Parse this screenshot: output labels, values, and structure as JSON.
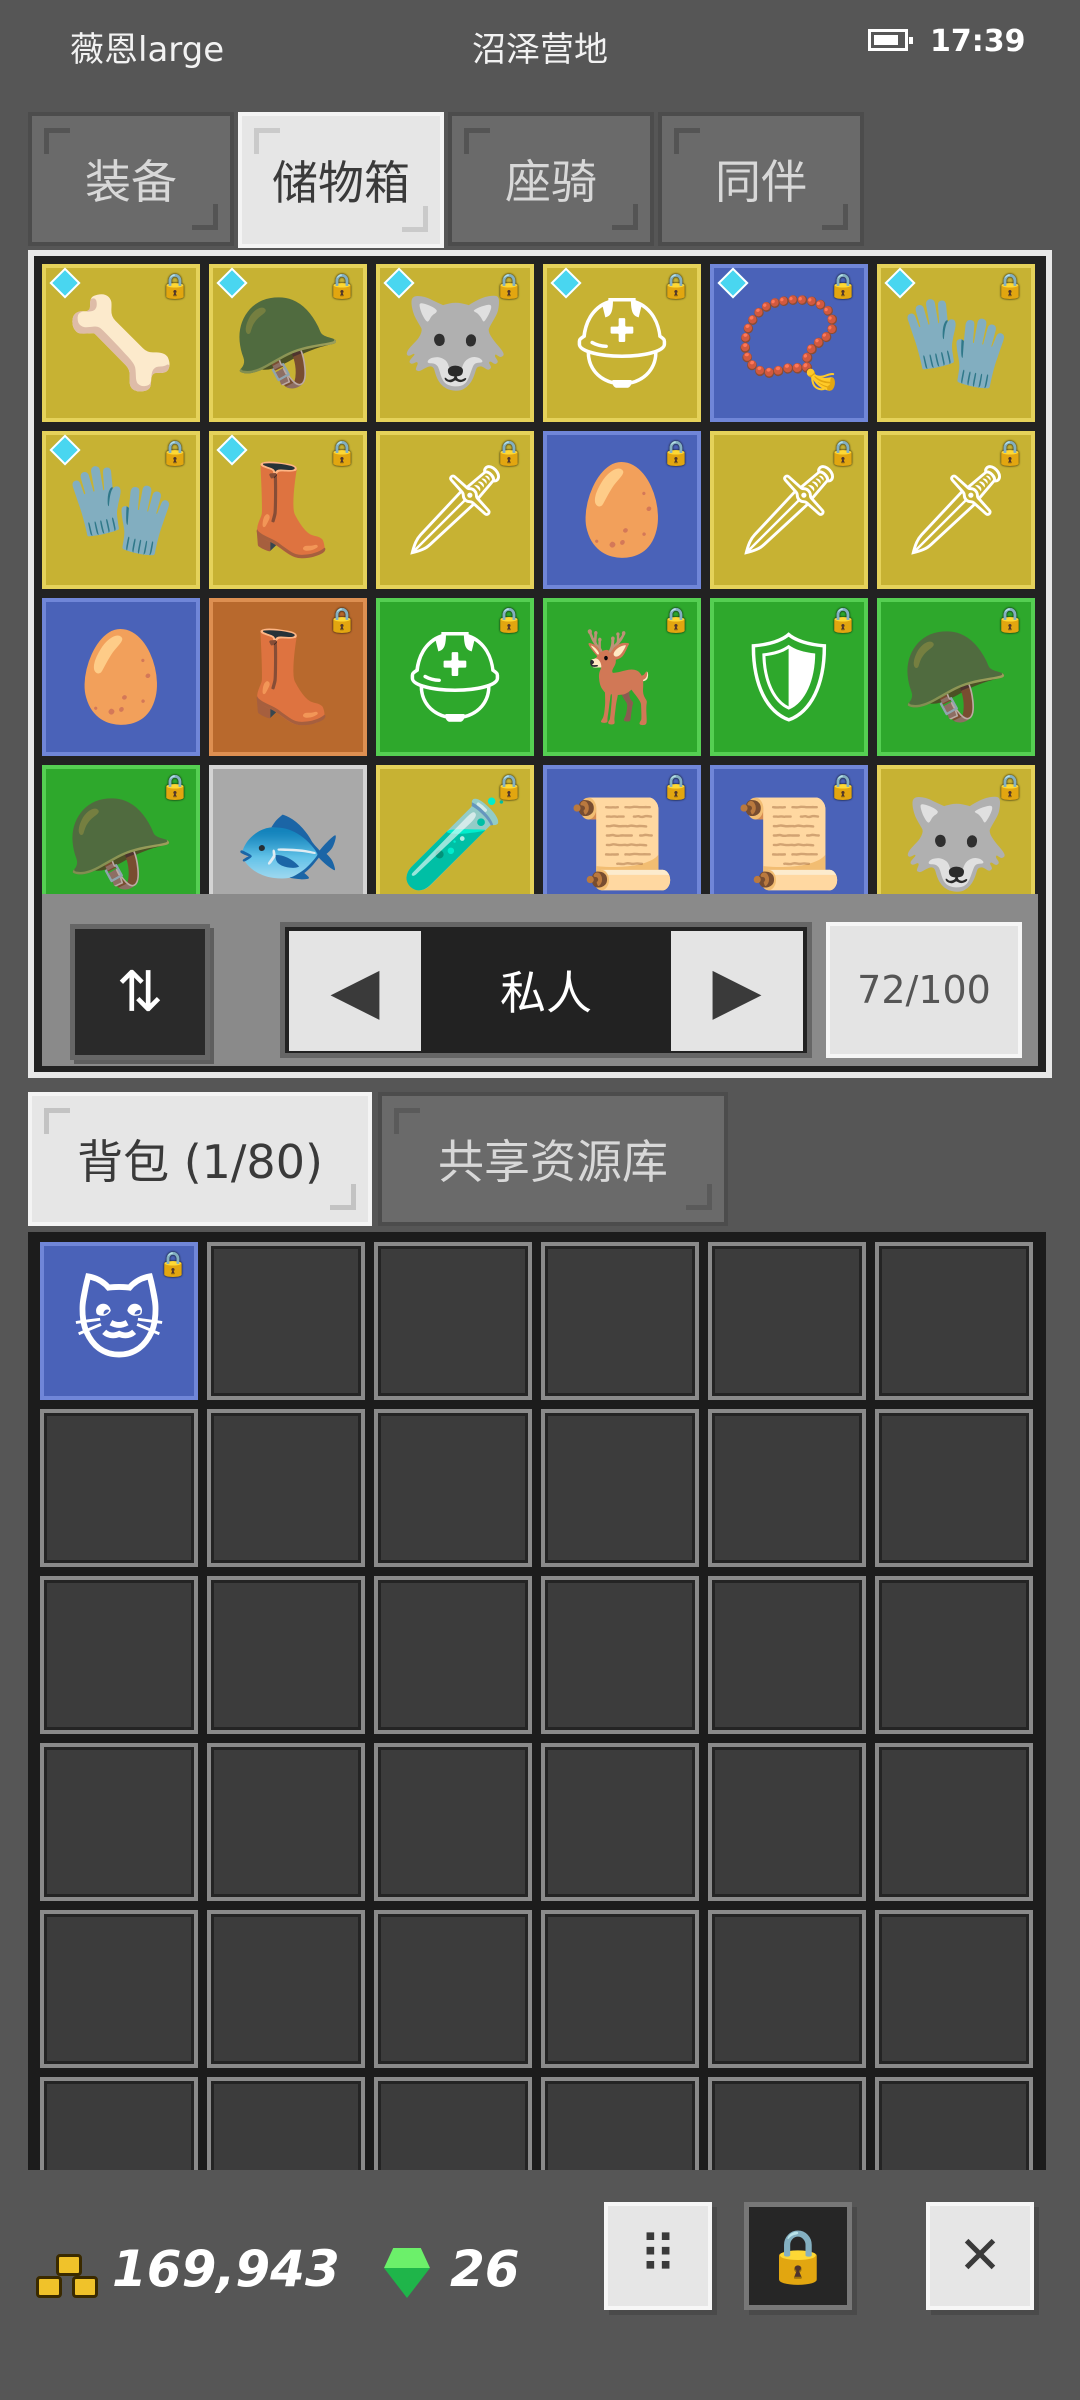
{
  "status_bar": {
    "player_name": "薇恩large",
    "location": "沼泽营地",
    "time": "17:39"
  },
  "top_tabs": [
    {
      "label": "装备",
      "active": false
    },
    {
      "label": "储物箱",
      "active": true
    },
    {
      "label": "座骑",
      "active": false
    },
    {
      "label": "同伴",
      "active": false
    }
  ],
  "storage": {
    "rows": [
      [
        {
          "color": "yellow",
          "icon": "rib-armor-icon",
          "glyph": "🦴",
          "gem": true,
          "locked": true
        },
        {
          "color": "yellow",
          "icon": "dark-helm-icon",
          "glyph": "🪖",
          "gem": true,
          "locked": true
        },
        {
          "color": "yellow",
          "icon": "fur-hood-icon",
          "glyph": "🐺",
          "gem": true,
          "locked": true
        },
        {
          "color": "yellow",
          "icon": "helmet-icon",
          "glyph": "⛑",
          "gem": true,
          "locked": true
        },
        {
          "color": "blue",
          "icon": "ruby-amulet-icon",
          "glyph": "📿",
          "gem": true,
          "locked": true
        },
        {
          "color": "yellow",
          "icon": "gauntlet-icon",
          "glyph": "🧤",
          "gem": true,
          "locked": true
        }
      ],
      [
        {
          "color": "yellow",
          "icon": "gauntlet-icon",
          "glyph": "🧤",
          "gem": true,
          "locked": true
        },
        {
          "color": "yellow",
          "icon": "boots-icon",
          "glyph": "👢",
          "gem": true,
          "locked": true
        },
        {
          "color": "yellow",
          "icon": "spear-icon",
          "glyph": "🗡",
          "gem": false,
          "locked": true
        },
        {
          "color": "blue",
          "icon": "white-egg-icon",
          "glyph": "🥚",
          "gem": false,
          "locked": true
        },
        {
          "color": "yellow",
          "icon": "spear-icon",
          "glyph": "🗡",
          "gem": false,
          "locked": true
        },
        {
          "color": "yellow",
          "icon": "spear-icon",
          "glyph": "🗡",
          "gem": false,
          "locked": true
        }
      ],
      [
        {
          "color": "blue",
          "icon": "egg-icon",
          "glyph": "🥚",
          "gem": false,
          "locked": false
        },
        {
          "color": "orange",
          "icon": "red-boots-icon",
          "glyph": "👢",
          "gem": false,
          "locked": true
        },
        {
          "color": "green",
          "icon": "helmet-icon",
          "glyph": "⛑",
          "gem": false,
          "locked": true
        },
        {
          "color": "green",
          "icon": "antler-helm-icon",
          "glyph": "🦌",
          "gem": false,
          "locked": true
        },
        {
          "color": "green",
          "icon": "chest-armor-icon",
          "glyph": "🛡",
          "gem": false,
          "locked": true
        },
        {
          "color": "green",
          "icon": "teal-helm-icon",
          "glyph": "🪖",
          "gem": false,
          "locked": true
        }
      ],
      [
        {
          "color": "green",
          "icon": "dark-helm-icon",
          "glyph": "🪖",
          "gem": false,
          "locked": true
        },
        {
          "color": "gray",
          "icon": "fish-icon",
          "glyph": "🐟",
          "gem": false,
          "locked": false
        },
        {
          "color": "yellow",
          "icon": "potion-icon",
          "glyph": "🧪",
          "gem": false,
          "locked": true
        },
        {
          "color": "blue",
          "icon": "scroll-icon",
          "glyph": "📜",
          "gem": false,
          "locked": true
        },
        {
          "color": "blue",
          "icon": "scroll-icon",
          "glyph": "📜",
          "gem": false,
          "locked": true
        },
        {
          "color": "yellow",
          "icon": "fur-hood-icon",
          "glyph": "🐺",
          "gem": false,
          "locked": true
        }
      ]
    ],
    "page_label": "私人",
    "capacity": "72/100"
  },
  "backpack_tabs": [
    {
      "label": "背包 (1/80)",
      "active": true
    },
    {
      "label": "共享资源库",
      "active": false
    }
  ],
  "backpack": {
    "first_item": {
      "color": "blue",
      "icon": "cat-hood-icon",
      "glyph": "🐱",
      "locked": true
    }
  },
  "bottom_bar": {
    "gold": "169,943",
    "gems": "26"
  },
  "colors": {
    "background": "#565656",
    "rarity_yellow": "#c7b233",
    "rarity_blue": "#4a62b8",
    "rarity_green": "#2ea82c",
    "rarity_orange": "#b8692d"
  }
}
